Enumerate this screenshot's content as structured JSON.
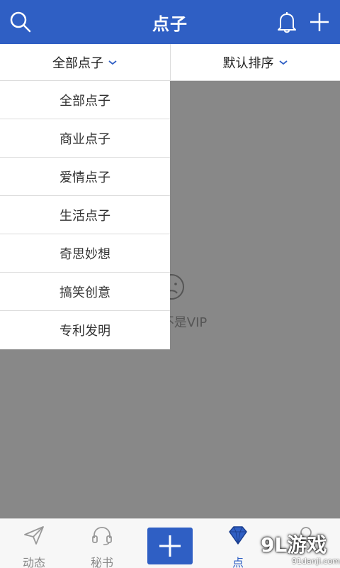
{
  "header": {
    "title": "点子",
    "icons": [
      "search-icon",
      "bell-icon",
      "plus-icon"
    ],
    "color": "#2f5fc4"
  },
  "filters": {
    "category": "全部点子",
    "sort": "默认排序"
  },
  "dropdown": {
    "items": [
      "全部点子",
      "商业点子",
      "爱情点子",
      "生活点子",
      "奇思妙想",
      "搞笑创意",
      "专利发明"
    ]
  },
  "content": {
    "message": "不是VIP",
    "icon": "sad-face-icon"
  },
  "tabbar": {
    "tabs": [
      {
        "label": "动态",
        "icon": "paper-plane-icon"
      },
      {
        "label": "秘书",
        "icon": "headset-icon"
      },
      {
        "label": "",
        "icon": "add-icon"
      },
      {
        "label": "点",
        "icon": "diamond-icon"
      },
      {
        "label": "",
        "icon": "user-icon"
      }
    ]
  },
  "watermark": {
    "logo": "9L游戏",
    "url": "91danji.com"
  }
}
